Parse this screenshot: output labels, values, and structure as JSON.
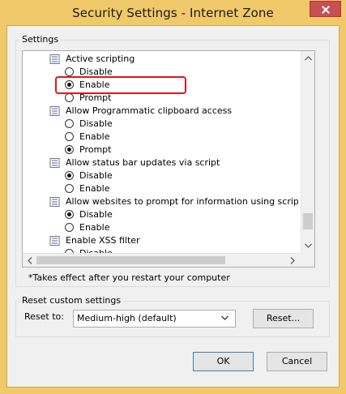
{
  "window": {
    "title": "Security Settings - Internet Zone"
  },
  "settings": {
    "group_label": "Settings",
    "rows": [
      {
        "type": "option",
        "label": "Active scripting",
        "kind": "header"
      },
      {
        "type": "option",
        "label": "Disable",
        "checked": false
      },
      {
        "type": "option",
        "label": "Enable",
        "checked": true
      },
      {
        "type": "option",
        "label": "Prompt",
        "checked": false
      },
      {
        "type": "option",
        "label": "Allow Programmatic clipboard access",
        "kind": "header"
      },
      {
        "type": "option",
        "label": "Disable",
        "checked": false
      },
      {
        "type": "option",
        "label": "Enable",
        "checked": false
      },
      {
        "type": "option",
        "label": "Prompt",
        "checked": true
      },
      {
        "type": "option",
        "label": "Allow status bar updates via script",
        "kind": "header"
      },
      {
        "type": "option",
        "label": "Disable",
        "checked": true
      },
      {
        "type": "option",
        "label": "Enable",
        "checked": false
      },
      {
        "type": "option",
        "label": "Allow websites to prompt for information using scripted windo",
        "kind": "header"
      },
      {
        "type": "option",
        "label": "Disable",
        "checked": true
      },
      {
        "type": "option",
        "label": "Enable",
        "checked": false
      },
      {
        "type": "option",
        "label": "Enable XSS filter",
        "kind": "header"
      },
      {
        "type": "option",
        "label": "Disable",
        "checked": false
      }
    ],
    "restart_note": "*Takes effect after you restart your computer"
  },
  "reset": {
    "group_label": "Reset custom settings",
    "reset_to_label": "Reset to:",
    "selected_level": "Medium-high (default)",
    "reset_button": "Reset..."
  },
  "footer": {
    "ok_button": "OK",
    "cancel_button": "Cancel"
  },
  "colors": {
    "title_bar": "#f0c96a",
    "close_button": "#c75050",
    "highlight_box": "#e0161b"
  }
}
